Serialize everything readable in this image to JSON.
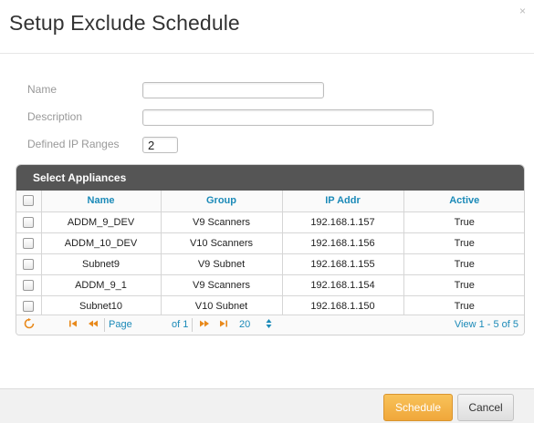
{
  "dialog": {
    "title": "Setup Exclude Schedule",
    "close_glyph": "×"
  },
  "form": {
    "name_label": "Name",
    "name_value": "",
    "description_label": "Description",
    "description_value": "",
    "ip_ranges_label": "Defined IP Ranges",
    "ip_ranges_value": "2"
  },
  "grid": {
    "caption": "Select Appliances",
    "columns": [
      "Name",
      "Group",
      "IP Addr",
      "Active"
    ],
    "rows": [
      {
        "name": "ADDM_9_DEV",
        "group": "V9 Scanners",
        "ip": "192.168.1.157",
        "active": "True"
      },
      {
        "name": "ADDM_10_DEV",
        "group": "V10 Scanners",
        "ip": "192.168.1.156",
        "active": "True"
      },
      {
        "name": "Subnet9",
        "group": "V9 Subnet",
        "ip": "192.168.1.155",
        "active": "True"
      },
      {
        "name": "ADDM_9_1",
        "group": "V9 Scanners",
        "ip": "192.168.1.154",
        "active": "True"
      },
      {
        "name": "Subnet10",
        "group": "V10 Subnet",
        "ip": "192.168.1.150",
        "active": "True"
      }
    ]
  },
  "pager": {
    "page_label": "Page",
    "page_value": "",
    "of_label": "of 1",
    "page_size": "20",
    "view_text": "View 1 - 5 of 5",
    "icons": {
      "refresh": "refresh-icon",
      "first": "first-page-icon",
      "prev": "prev-page-icon",
      "next": "next-page-icon",
      "last": "last-page-icon",
      "size_select": "select-arrows-icon"
    }
  },
  "footer": {
    "schedule_label": "Schedule",
    "cancel_label": "Cancel"
  },
  "colors": {
    "header_bar": "#555555",
    "column_header_text": "#1b8ab8",
    "pager_icons": "#e8891b",
    "schedule_button": "#f0a73a"
  }
}
